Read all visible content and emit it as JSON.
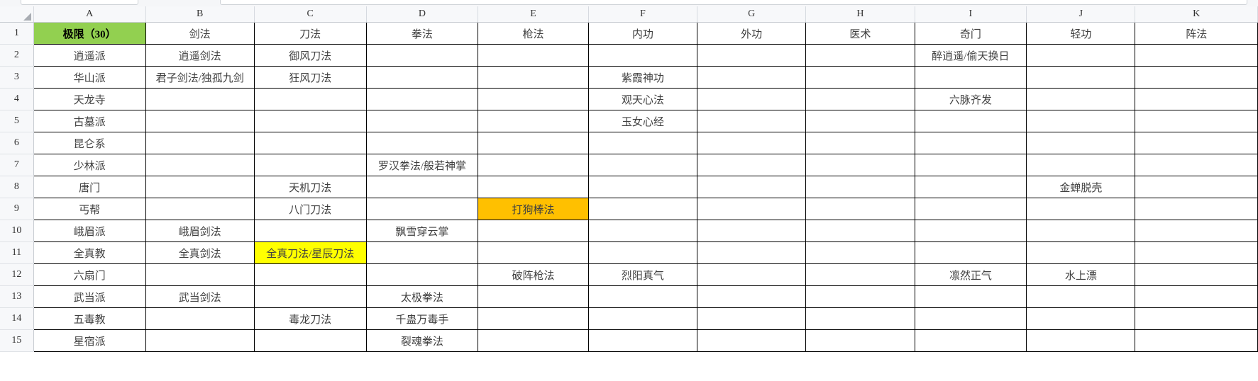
{
  "app": {
    "type": "spreadsheet",
    "name_box_value": "",
    "formula_bar_value": ""
  },
  "colors": {
    "title_fill": "#92d050",
    "highlight_yellow": "#ffff00",
    "highlight_orange": "#ffc000",
    "grid_line": "#000000",
    "header_background": "#f7f8fa"
  },
  "grid": {
    "column_letters": [
      "A",
      "B",
      "C",
      "D",
      "E",
      "F",
      "G",
      "H",
      "I",
      "J",
      "K"
    ],
    "row_numbers": [
      "1",
      "2",
      "3",
      "4",
      "5",
      "6",
      "7",
      "8",
      "9",
      "10",
      "11",
      "12",
      "13",
      "14",
      "15"
    ]
  },
  "sheet": {
    "rows": [
      {
        "num": "1",
        "cells": [
          {
            "text": "极限（30）",
            "fill": "green",
            "bold": true
          },
          {
            "text": "剑法"
          },
          {
            "text": "刀法"
          },
          {
            "text": "拳法"
          },
          {
            "text": "枪法"
          },
          {
            "text": "内功"
          },
          {
            "text": "外功"
          },
          {
            "text": "医术"
          },
          {
            "text": "奇门"
          },
          {
            "text": "轻功"
          },
          {
            "text": "阵法"
          }
        ]
      },
      {
        "num": "2",
        "cells": [
          {
            "text": "逍遥派"
          },
          {
            "text": "逍遥剑法"
          },
          {
            "text": "御风刀法"
          },
          {
            "text": ""
          },
          {
            "text": ""
          },
          {
            "text": ""
          },
          {
            "text": ""
          },
          {
            "text": ""
          },
          {
            "text": "醉逍遥/偷天换日"
          },
          {
            "text": ""
          },
          {
            "text": ""
          }
        ]
      },
      {
        "num": "3",
        "cells": [
          {
            "text": "华山派"
          },
          {
            "text": "君子剑法/独孤九剑"
          },
          {
            "text": "狂风刀法"
          },
          {
            "text": ""
          },
          {
            "text": ""
          },
          {
            "text": "紫霞神功"
          },
          {
            "text": ""
          },
          {
            "text": ""
          },
          {
            "text": ""
          },
          {
            "text": ""
          },
          {
            "text": ""
          }
        ]
      },
      {
        "num": "4",
        "cells": [
          {
            "text": "天龙寺"
          },
          {
            "text": ""
          },
          {
            "text": ""
          },
          {
            "text": ""
          },
          {
            "text": ""
          },
          {
            "text": "观天心法"
          },
          {
            "text": ""
          },
          {
            "text": ""
          },
          {
            "text": "六脉齐发"
          },
          {
            "text": ""
          },
          {
            "text": ""
          }
        ]
      },
      {
        "num": "5",
        "cells": [
          {
            "text": "古墓派"
          },
          {
            "text": ""
          },
          {
            "text": ""
          },
          {
            "text": ""
          },
          {
            "text": ""
          },
          {
            "text": "玉女心经"
          },
          {
            "text": ""
          },
          {
            "text": ""
          },
          {
            "text": ""
          },
          {
            "text": ""
          },
          {
            "text": ""
          }
        ]
      },
      {
        "num": "6",
        "cells": [
          {
            "text": "昆仑系"
          },
          {
            "text": ""
          },
          {
            "text": ""
          },
          {
            "text": ""
          },
          {
            "text": ""
          },
          {
            "text": ""
          },
          {
            "text": ""
          },
          {
            "text": ""
          },
          {
            "text": ""
          },
          {
            "text": ""
          },
          {
            "text": ""
          }
        ]
      },
      {
        "num": "7",
        "cells": [
          {
            "text": "少林派"
          },
          {
            "text": ""
          },
          {
            "text": ""
          },
          {
            "text": "罗汉拳法/般若神掌"
          },
          {
            "text": ""
          },
          {
            "text": ""
          },
          {
            "text": ""
          },
          {
            "text": ""
          },
          {
            "text": ""
          },
          {
            "text": ""
          },
          {
            "text": ""
          }
        ]
      },
      {
        "num": "8",
        "cells": [
          {
            "text": "唐门"
          },
          {
            "text": ""
          },
          {
            "text": "天机刀法"
          },
          {
            "text": ""
          },
          {
            "text": ""
          },
          {
            "text": ""
          },
          {
            "text": ""
          },
          {
            "text": ""
          },
          {
            "text": ""
          },
          {
            "text": "金蝉脱壳"
          },
          {
            "text": ""
          }
        ]
      },
      {
        "num": "9",
        "cells": [
          {
            "text": "丐帮"
          },
          {
            "text": ""
          },
          {
            "text": "八门刀法"
          },
          {
            "text": ""
          },
          {
            "text": "打狗棒法",
            "fill": "orange"
          },
          {
            "text": ""
          },
          {
            "text": ""
          },
          {
            "text": ""
          },
          {
            "text": ""
          },
          {
            "text": ""
          },
          {
            "text": ""
          }
        ]
      },
      {
        "num": "10",
        "cells": [
          {
            "text": "峨眉派"
          },
          {
            "text": "峨眉剑法"
          },
          {
            "text": ""
          },
          {
            "text": "飘雪穿云掌"
          },
          {
            "text": ""
          },
          {
            "text": ""
          },
          {
            "text": ""
          },
          {
            "text": ""
          },
          {
            "text": ""
          },
          {
            "text": ""
          },
          {
            "text": ""
          }
        ]
      },
      {
        "num": "11",
        "cells": [
          {
            "text": "全真教"
          },
          {
            "text": "全真剑法"
          },
          {
            "text": "全真刀法/星辰刀法",
            "fill": "yellow"
          },
          {
            "text": ""
          },
          {
            "text": ""
          },
          {
            "text": ""
          },
          {
            "text": ""
          },
          {
            "text": ""
          },
          {
            "text": ""
          },
          {
            "text": ""
          },
          {
            "text": ""
          }
        ]
      },
      {
        "num": "12",
        "cells": [
          {
            "text": "六扇门"
          },
          {
            "text": ""
          },
          {
            "text": ""
          },
          {
            "text": ""
          },
          {
            "text": "破阵枪法"
          },
          {
            "text": "烈阳真气"
          },
          {
            "text": ""
          },
          {
            "text": ""
          },
          {
            "text": "凛然正气"
          },
          {
            "text": "水上漂"
          },
          {
            "text": ""
          }
        ]
      },
      {
        "num": "13",
        "cells": [
          {
            "text": "武当派"
          },
          {
            "text": "武当剑法"
          },
          {
            "text": ""
          },
          {
            "text": "太极拳法"
          },
          {
            "text": ""
          },
          {
            "text": ""
          },
          {
            "text": ""
          },
          {
            "text": ""
          },
          {
            "text": ""
          },
          {
            "text": ""
          },
          {
            "text": ""
          }
        ]
      },
      {
        "num": "14",
        "cells": [
          {
            "text": "五毒教"
          },
          {
            "text": ""
          },
          {
            "text": "毒龙刀法"
          },
          {
            "text": "千蛊万毒手"
          },
          {
            "text": ""
          },
          {
            "text": ""
          },
          {
            "text": ""
          },
          {
            "text": ""
          },
          {
            "text": ""
          },
          {
            "text": ""
          },
          {
            "text": ""
          }
        ]
      },
      {
        "num": "15",
        "cells": [
          {
            "text": "星宿派"
          },
          {
            "text": ""
          },
          {
            "text": ""
          },
          {
            "text": "裂魂拳法"
          },
          {
            "text": ""
          },
          {
            "text": ""
          },
          {
            "text": ""
          },
          {
            "text": ""
          },
          {
            "text": ""
          },
          {
            "text": ""
          },
          {
            "text": ""
          }
        ]
      }
    ]
  }
}
